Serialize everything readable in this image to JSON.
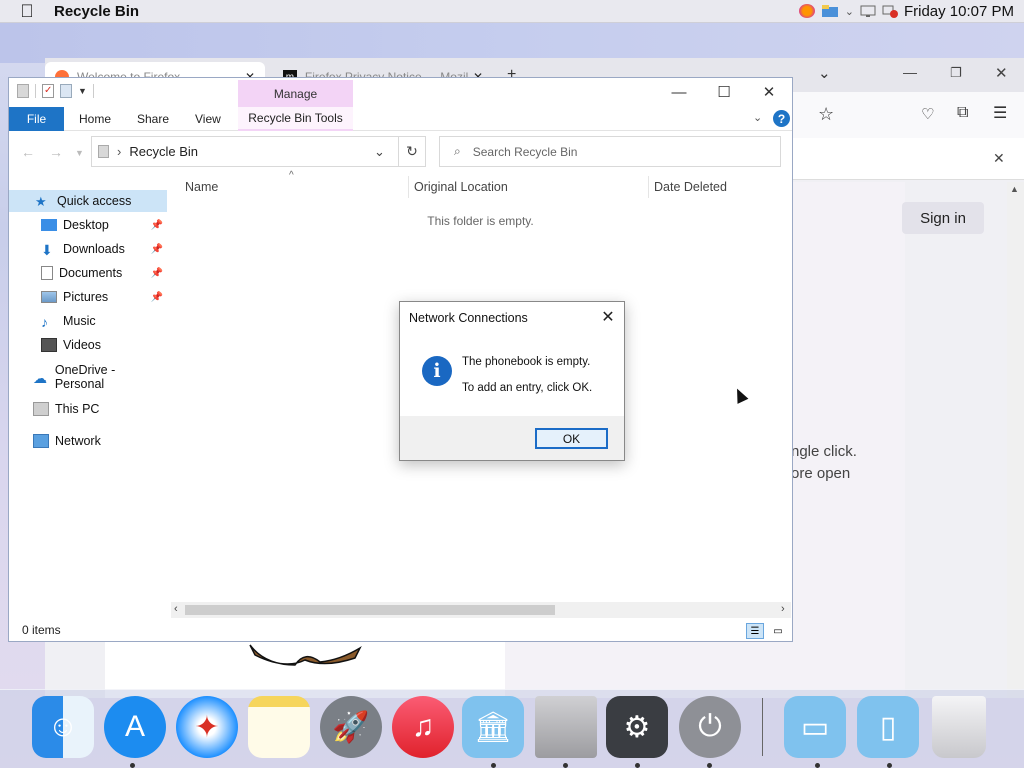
{
  "menubar": {
    "app_title": "Recycle Bin",
    "datetime": "Friday 10:07 PM"
  },
  "firefox": {
    "tabs": [
      {
        "label": "Welcome to Firefox"
      },
      {
        "label": "Firefox Privacy Notice — Mozil"
      }
    ],
    "sign_in_label": "Sign in",
    "partial_text_1": "ngle click.",
    "partial_text_2": "ore open"
  },
  "explorer": {
    "manage_label": "Manage",
    "ribbon_tabs": {
      "file": "File",
      "home": "Home",
      "share": "Share",
      "view": "View",
      "tools": "Recycle Bin Tools"
    },
    "address": "Recycle Bin",
    "search_placeholder": "Search Recycle Bin",
    "nav": {
      "quick_access": "Quick access",
      "desktop": "Desktop",
      "downloads": "Downloads",
      "documents": "Documents",
      "pictures": "Pictures",
      "music": "Music",
      "videos": "Videos",
      "onedrive": "OneDrive - Personal",
      "this_pc": "This PC",
      "network": "Network"
    },
    "columns": {
      "name": "Name",
      "original_location": "Original Location",
      "date_deleted": "Date Deleted"
    },
    "empty_message": "This folder is empty.",
    "status": "0 items"
  },
  "dialog": {
    "title": "Network Connections",
    "line1": "The phonebook is empty.",
    "line2": "To add an entry, click OK.",
    "ok_label": "OK"
  },
  "dock": {
    "items": [
      "finder-icon",
      "app-store-icon",
      "safari-icon",
      "notes-icon",
      "launchpad-icon",
      "music-icon",
      "library-folder-icon",
      "mac-pro-icon",
      "system-preferences-icon",
      "power-icon",
      "window-folder-icon",
      "document-folder-icon",
      "trash-icon"
    ]
  },
  "colors": {
    "accent": "#1e74c6",
    "manage_tab": "#f3d4f6",
    "selection": "#cce4f7",
    "info_icon": "#1a68c2"
  }
}
